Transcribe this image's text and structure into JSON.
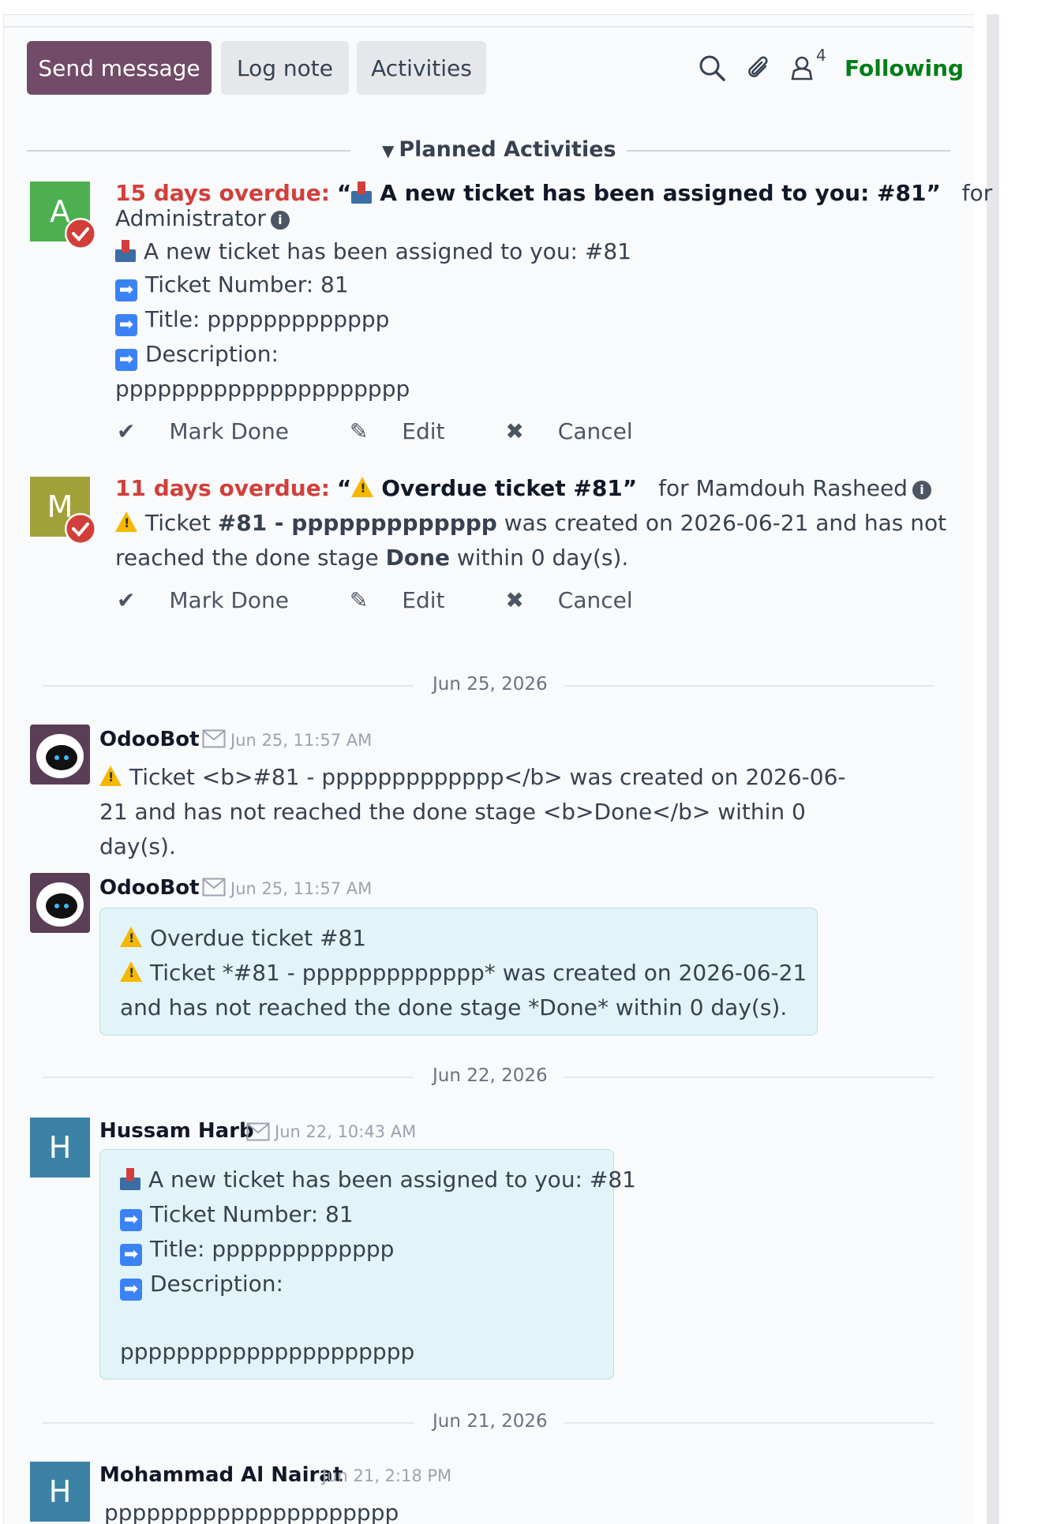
{
  "toolbar": {
    "send_message": "Send message",
    "log_note": "Log note",
    "activities": "Activities",
    "follower_count": "4",
    "following": "Following",
    "icons": [
      "search-icon",
      "paperclip-icon",
      "followers-icon"
    ]
  },
  "planned": {
    "label": "Planned Activities",
    "activities": [
      {
        "avatar_letter": "A",
        "overdue": "15 days overdue:",
        "title": "A new ticket has been assigned to you: #81",
        "for_prefix": "for",
        "assignee": "Administrator",
        "lines": {
          "assigned": "A new ticket has been assigned to you: #81",
          "number": "Ticket Number: 81",
          "title": "Title: ppppppppppppp",
          "description": "Description:",
          "desc_value": "ppppppppppppppppppppp"
        },
        "mark_done": "Mark Done",
        "edit": "Edit",
        "cancel": "Cancel"
      },
      {
        "avatar_letter": "M",
        "overdue": "11 days overdue:",
        "title": "Overdue ticket #81",
        "for_prefix": "for Mamdouh Rasheed",
        "body_1": "Ticket",
        "body_bold": "#81 - ppppppppppppp",
        "body_2": "was created on 2026-06-21 and has not",
        "body_3": "reached the done stage",
        "body_done": "Done",
        "body_4": "within 0 day(s).",
        "mark_done": "Mark Done",
        "edit": "Edit",
        "cancel": "Cancel"
      }
    ]
  },
  "messages": {
    "date_1": "Jun 25, 2026",
    "date_2": "Jun 22, 2026",
    "date_3": "Jun 21, 2026",
    "m1": {
      "author": "OdooBot",
      "time": "Jun 25, 11:57 AM",
      "line1": "Ticket <b>#81 - ppppppppppppp</b> was created on 2026-06-",
      "line2": "21 and has not reached the done stage <b>Done</b> within 0",
      "line3": "day(s)."
    },
    "m2": {
      "author": "OdooBot",
      "time": "Jun 25, 11:57 AM",
      "line1": "Overdue ticket #81",
      "line2": "Ticket *#81 - ppppppppppppp* was created on 2026-06-21",
      "line3": "and has not reached the done stage *Done* within 0 day(s)."
    },
    "m3": {
      "avatar_letter": "H",
      "author": "Hussam Harb",
      "time": "Jun 22, 10:43 AM",
      "line1": "A new ticket has been assigned to you: #81",
      "line2": "Ticket Number: 81",
      "line3": "Title: ppppppppppppp",
      "line4": "Description:",
      "line5": "ppppppppppppppppppppp"
    },
    "m4": {
      "avatar_letter": "H",
      "author": "Mohammad Al Nairat",
      "time": "Jun 21, 2:18 PM",
      "line1": "ppppppppppppppppppppp"
    }
  },
  "colors": {
    "primary": "#714b67",
    "overdue": "#d23f3a",
    "following": "#017e16",
    "bubble": "#e2f4f7"
  }
}
